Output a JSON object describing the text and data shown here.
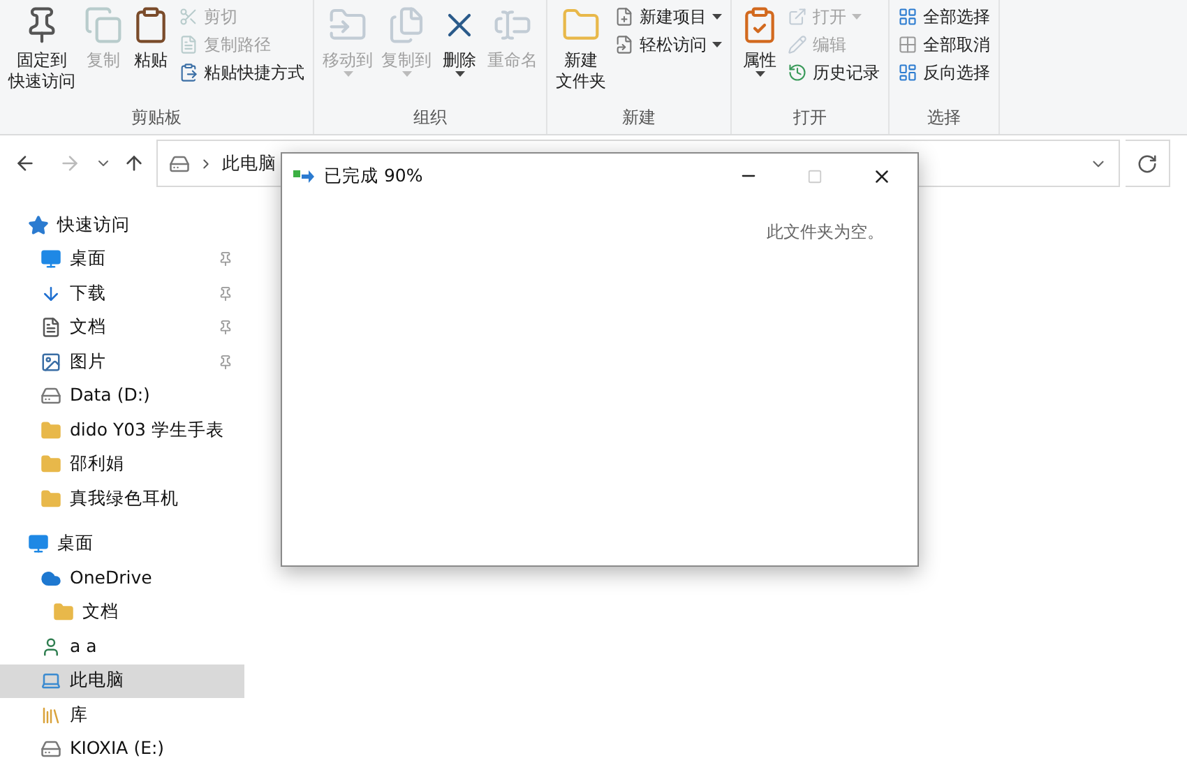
{
  "ribbon": {
    "groups": [
      {
        "label": "剪贴板",
        "items": [
          {
            "kind": "large",
            "label": [
              "固定到",
              "快速访问"
            ],
            "disabled": false
          },
          {
            "kind": "large",
            "label": [
              "复制"
            ],
            "disabled": true
          },
          {
            "kind": "large",
            "label": [
              "粘贴"
            ],
            "disabled": false
          },
          {
            "kind": "stack",
            "items": [
              {
                "label": "剪切",
                "disabled": true
              },
              {
                "label": "复制路径",
                "disabled": true
              },
              {
                "label": "粘贴快捷方式",
                "disabled": false
              }
            ]
          }
        ]
      },
      {
        "label": "组织",
        "items": [
          {
            "kind": "large",
            "label": [
              "移动到"
            ],
            "disabled": true,
            "has_menu": true
          },
          {
            "kind": "large",
            "label": [
              "复制到"
            ],
            "disabled": true,
            "has_menu": true
          },
          {
            "kind": "large",
            "label": [
              "删除"
            ],
            "disabled": false,
            "has_menu": true
          },
          {
            "kind": "large",
            "label": [
              "重命名"
            ],
            "disabled": true
          }
        ]
      },
      {
        "label": "新建",
        "items": [
          {
            "kind": "large",
            "label": [
              "新建",
              "文件夹"
            ],
            "disabled": false
          },
          {
            "kind": "stack",
            "items": [
              {
                "label": "新建项目",
                "disabled": false,
                "has_menu": true
              },
              {
                "label": "轻松访问",
                "disabled": false,
                "has_menu": true
              }
            ]
          }
        ]
      },
      {
        "label": "打开",
        "items": [
          {
            "kind": "large",
            "label": [
              "属性"
            ],
            "disabled": false,
            "has_menu": true
          },
          {
            "kind": "stack",
            "items": [
              {
                "label": "打开",
                "disabled": true,
                "has_menu": true
              },
              {
                "label": "编辑",
                "disabled": true
              },
              {
                "label": "历史记录",
                "disabled": false
              }
            ]
          }
        ]
      },
      {
        "label": "选择",
        "items": [
          {
            "kind": "stack",
            "items": [
              {
                "label": "全部选择",
                "disabled": false
              },
              {
                "label": "全部取消",
                "disabled": false
              },
              {
                "label": "反向选择",
                "disabled": false
              }
            ]
          }
        ]
      }
    ]
  },
  "address": {
    "path": [
      "此电脑"
    ]
  },
  "sidebar": {
    "items": [
      {
        "label": "快速访问",
        "selected": false,
        "children": [
          {
            "label": "桌面",
            "pinned": true,
            "selected": false
          },
          {
            "label": "下载",
            "pinned": true,
            "selected": false
          },
          {
            "label": "文档",
            "pinned": true,
            "selected": false
          },
          {
            "label": "图片",
            "pinned": true,
            "selected": false
          },
          {
            "label": "Data (D:)",
            "pinned": false,
            "selected": false
          },
          {
            "label": "dido Y03 学生手表",
            "pinned": false,
            "selected": false
          },
          {
            "label": "邵利娟",
            "pinned": false,
            "selected": false
          },
          {
            "label": "真我绿色耳机",
            "pinned": false,
            "selected": false
          }
        ]
      },
      {
        "label": "桌面",
        "selected": false,
        "children": [
          {
            "label": "OneDrive",
            "selected": false,
            "children": [
              {
                "label": "文档",
                "selected": false
              }
            ]
          },
          {
            "label": "a a",
            "selected": false
          },
          {
            "label": "此电脑",
            "selected": true
          },
          {
            "label": "库",
            "selected": false
          },
          {
            "label": "KIOXIA (E:)",
            "selected": false
          }
        ]
      }
    ]
  },
  "empty_message": "此文件夹为空。",
  "dialog": {
    "title": "已完成 90%"
  }
}
